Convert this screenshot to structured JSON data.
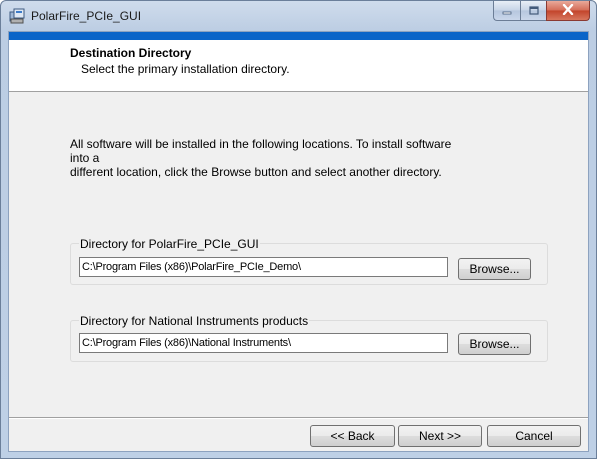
{
  "window": {
    "title": "PolarFire_PCIe_GUI"
  },
  "header": {
    "title": "Destination Directory",
    "subtitle": "Select the primary installation directory."
  },
  "body": {
    "line1": "All software will be installed in the following locations. To install software into a",
    "line2": "different location, click the Browse button and select another directory."
  },
  "directories": [
    {
      "label": "Directory for PolarFire_PCIe_GUI",
      "path": "C:\\Program Files (x86)\\PolarFire_PCIe_Demo\\",
      "browse_label": "Browse..."
    },
    {
      "label": "Directory for National Instruments products",
      "path": "C:\\Program Files (x86)\\National Instruments\\",
      "browse_label": "Browse..."
    }
  ],
  "footer": {
    "back_label": "<< Back",
    "next_label": "Next >>",
    "cancel_label": "Cancel"
  },
  "icons": {
    "app": "installer-app-icon",
    "minimize": "minimize-icon",
    "maximize": "maximize-icon",
    "close": "close-icon"
  }
}
